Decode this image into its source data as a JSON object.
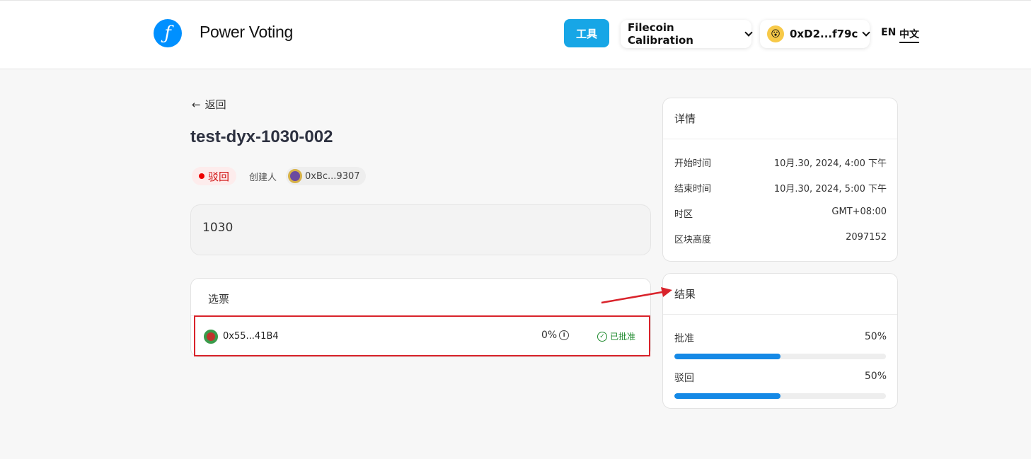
{
  "header": {
    "app_title": "Power Voting",
    "logo_glyph": "ƒ",
    "tools_label": "工具",
    "network_label": "Filecoin Calibration",
    "wallet_label": "0xD2...f79c",
    "lang_en": "EN",
    "lang_zh": "中文"
  },
  "proposal": {
    "back_label": "返回",
    "title": "test-dyx-1030-002",
    "status": "驳回",
    "creator_label": "创建人",
    "creator_address": "0xBc...9307",
    "description": "1030"
  },
  "votes": {
    "heading": "选票",
    "rows": [
      {
        "address": "0x55...41B4",
        "percent": "0%",
        "status": "已批准"
      }
    ]
  },
  "details": {
    "heading": "详情",
    "rows": [
      {
        "label": "开始时间",
        "value": "10月.30, 2024, 4:00 下午"
      },
      {
        "label": "结束时间",
        "value": "10月.30, 2024, 5:00 下午"
      },
      {
        "label": "时区",
        "value": "GMT+08:00"
      },
      {
        "label": "区块高度",
        "value": "2097152"
      }
    ]
  },
  "results": {
    "heading": "结果",
    "options": [
      {
        "label": "批准",
        "percent_text": "50%",
        "percent": 50
      },
      {
        "label": "驳回",
        "percent_text": "50%",
        "percent": 50
      }
    ]
  },
  "colors": {
    "accent": "#1589e6",
    "tools_button": "#17a6e6",
    "reject": "#d10f0f",
    "approve": "#1f8a2e",
    "annotation": "#d9232b"
  }
}
